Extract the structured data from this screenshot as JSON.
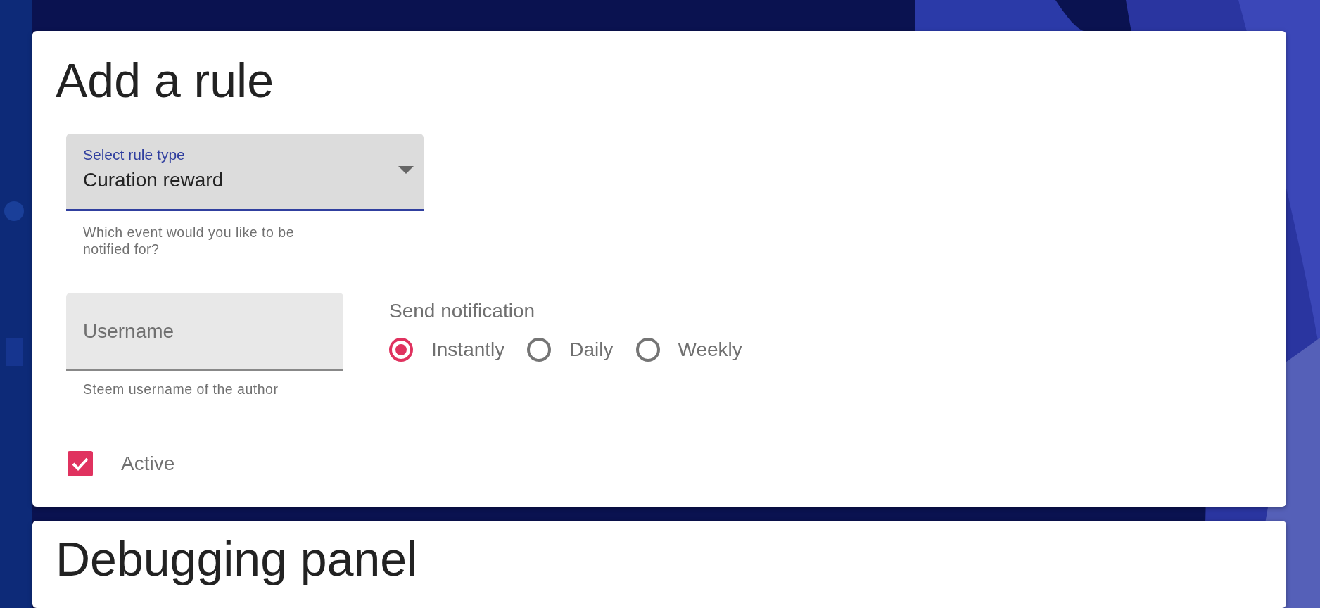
{
  "card": {
    "title": "Add a rule",
    "rule_type_select": {
      "label": "Select rule type",
      "value": "Curation reward",
      "helper": "Which event would you like to be notified for?",
      "focused": true
    },
    "username_field": {
      "placeholder": "Username",
      "helper": "Steem username of the author"
    },
    "send_notification": {
      "label": "Send notification",
      "options": [
        {
          "label": "Instantly",
          "selected": true
        },
        {
          "label": "Daily",
          "selected": false
        },
        {
          "label": "Weekly",
          "selected": false
        }
      ]
    },
    "active_checkbox": {
      "label": "Active",
      "checked": true
    }
  },
  "next_card": {
    "title": "Debugging panel"
  }
}
